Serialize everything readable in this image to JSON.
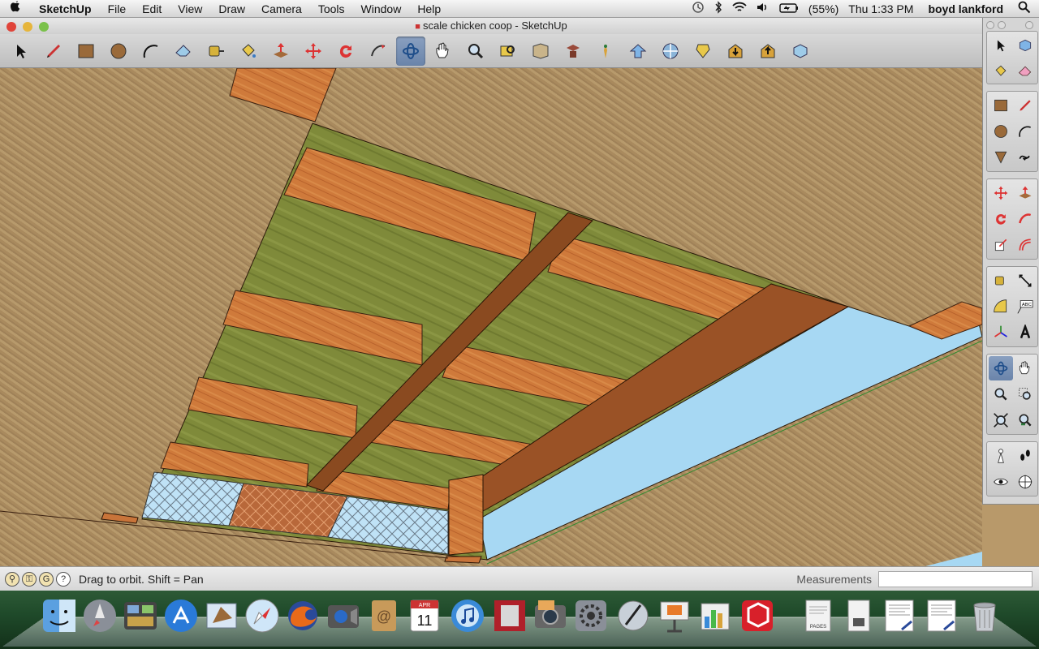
{
  "menubar": {
    "apple_icon": "apple-icon",
    "app_name": "SketchUp",
    "menus": [
      "File",
      "Edit",
      "View",
      "Draw",
      "Camera",
      "Tools",
      "Window",
      "Help"
    ],
    "battery": "(55%)",
    "clock": "Thu 1:33 PM",
    "user": "boyd lankford"
  },
  "window": {
    "title": "scale chicken coop - SketchUp"
  },
  "toolbar": {
    "tools": [
      "select-icon",
      "pencil-icon",
      "rectangle-icon",
      "circle-icon",
      "arc-icon",
      "eraser-icon",
      "tape-measure-icon",
      "paint-bucket-icon",
      "push-pull-icon",
      "move-icon",
      "rotate-icon",
      "follow-me-icon",
      "orbit-icon",
      "pan-icon",
      "zoom-icon",
      "zoom-window-icon",
      "zoom-extents-icon",
      "previous-view-icon",
      "next-view-icon",
      "position-camera-icon",
      "walk-icon",
      "look-around-icon",
      "get-models-icon",
      "share-model-icon",
      "component-icon"
    ],
    "active_tool": "orbit-icon"
  },
  "statusbar": {
    "hint": "Drag to orbit.  Shift = Pan",
    "measurements_label": "Measurements",
    "measurements_value": ""
  },
  "colors": {
    "accent_active": "#6a84aa",
    "ground": "#a98a5e",
    "wood": "#c8743a",
    "plywood": "#7d8a3a",
    "sky": "#a7d8f3"
  },
  "dock": {
    "items": [
      "finder-icon",
      "launchpad-icon",
      "mission-control-icon",
      "app-store-icon",
      "mail-icon",
      "safari-icon",
      "firefox-icon",
      "facetime-icon",
      "address-book-icon",
      "ical-icon",
      "itunes-icon",
      "photo-booth-icon",
      "iphoto-icon",
      "system-preferences-icon",
      "script-editor-icon",
      "keynote-icon",
      "numbers-icon",
      "sketchup-icon",
      "pages-icon",
      "document-icon",
      "text-document-icon",
      "text-document-2-icon",
      "trash-icon"
    ],
    "ical_month": "APR",
    "ical_day": "11",
    "pages_label": "PAGES"
  }
}
